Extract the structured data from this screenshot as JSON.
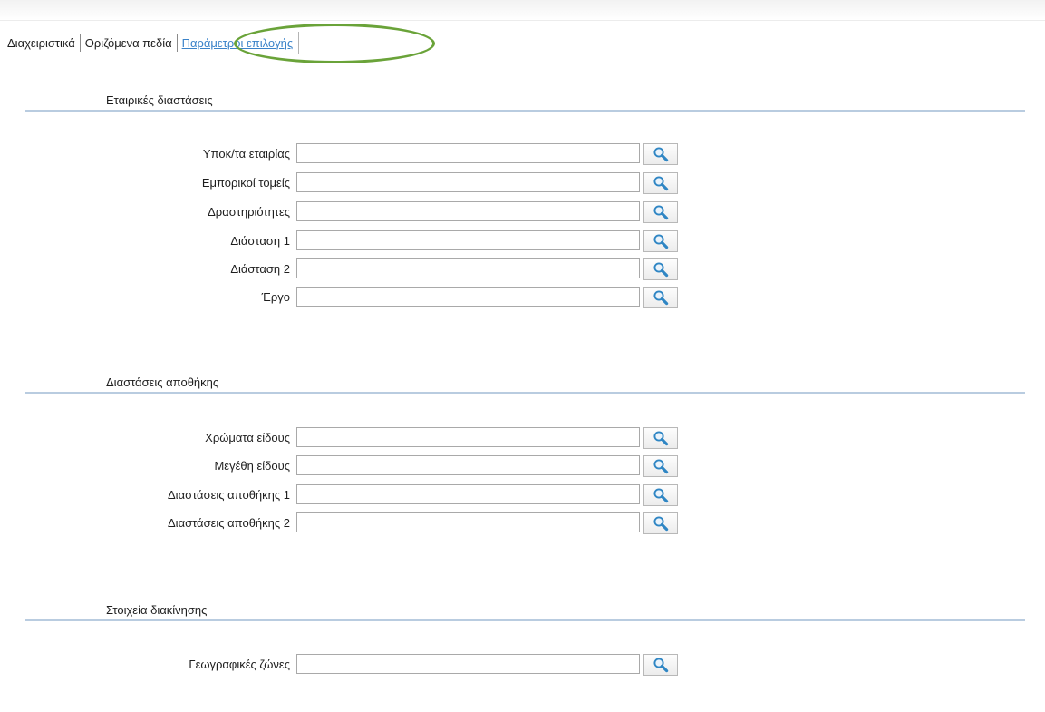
{
  "tabs": [
    {
      "label": "Διαχειριστικά"
    },
    {
      "label": "Οριζόμενα πεδία"
    },
    {
      "label": "Παράμετροι επιλογής",
      "active": true
    }
  ],
  "sections": [
    {
      "title": "Εταιρικές διαστάσεις",
      "fields": [
        {
          "label": "Υποκ/τα εταιρίας",
          "value": ""
        },
        {
          "label": "Εμπορικοί τομείς",
          "value": ""
        },
        {
          "label": "Δραστηριότητες",
          "value": ""
        },
        {
          "label": "Διάσταση 1",
          "value": ""
        },
        {
          "label": "Διάσταση 2",
          "value": ""
        },
        {
          "label": "Έργο",
          "value": ""
        }
      ]
    },
    {
      "title": "Διαστάσεις αποθήκης",
      "fields": [
        {
          "label": "Χρώματα είδους",
          "value": ""
        },
        {
          "label": "Μεγέθη είδους",
          "value": ""
        },
        {
          "label": "Διαστάσεις αποθήκης 1",
          "value": ""
        },
        {
          "label": "Διαστάσεις αποθήκης 2",
          "value": ""
        }
      ]
    },
    {
      "title": "Στοιχεία διακίνησης",
      "fields": [
        {
          "label": "Γεωγραφικές ζώνες",
          "value": ""
        }
      ]
    }
  ],
  "icons": {
    "lookup": "magnifier-icon"
  },
  "colors": {
    "active_tab": "#3b83c9",
    "highlight": "#6aa339",
    "section_rule": "#b9cce0",
    "icon_glass": "#2f86c4"
  }
}
